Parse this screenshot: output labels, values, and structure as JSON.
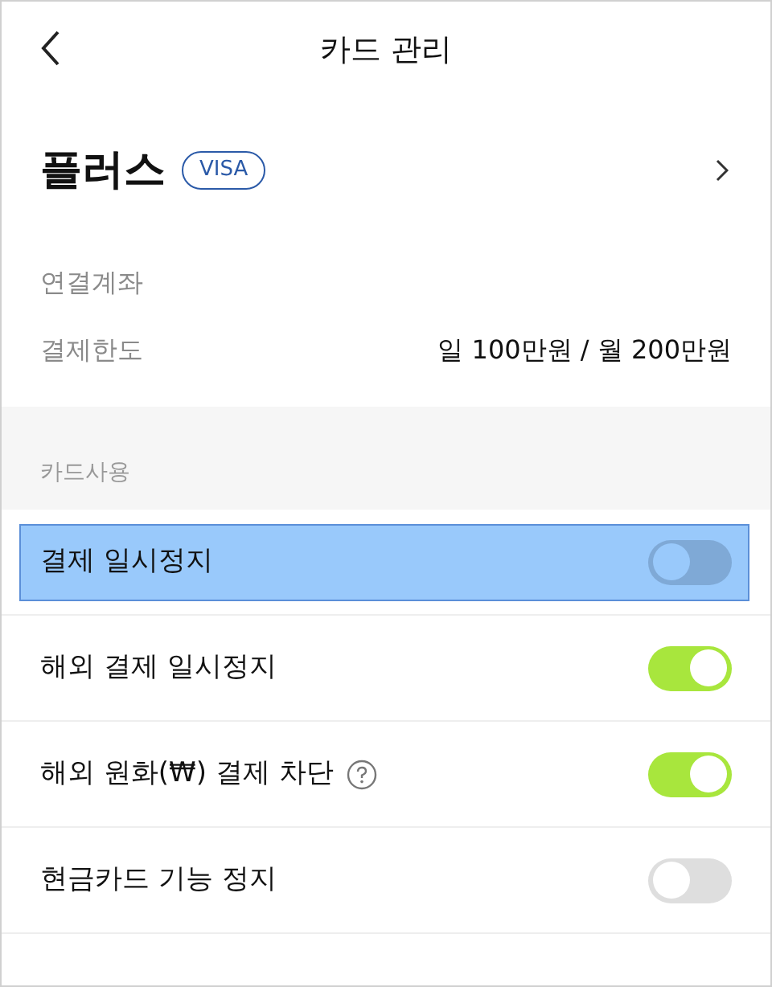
{
  "header": {
    "title": "카드 관리"
  },
  "card": {
    "name": "플러스",
    "brand": "VISA"
  },
  "info": [
    {
      "label": "연결계좌"
    },
    {
      "label": "결제한도",
      "value": "일 100만원 / 월 200만원"
    }
  ],
  "section": {
    "title": "카드사용"
  },
  "settings": [
    {
      "label": "결제 일시정지",
      "on": false,
      "selected": true,
      "help": false
    },
    {
      "label": "해외 결제 일시정지",
      "on": true,
      "selected": false,
      "help": false
    },
    {
      "label": "해외 원화(₩) 결제 차단",
      "on": true,
      "selected": false,
      "help": true
    },
    {
      "label": "현금카드 기능 정지",
      "on": false,
      "selected": false,
      "help": false
    }
  ]
}
